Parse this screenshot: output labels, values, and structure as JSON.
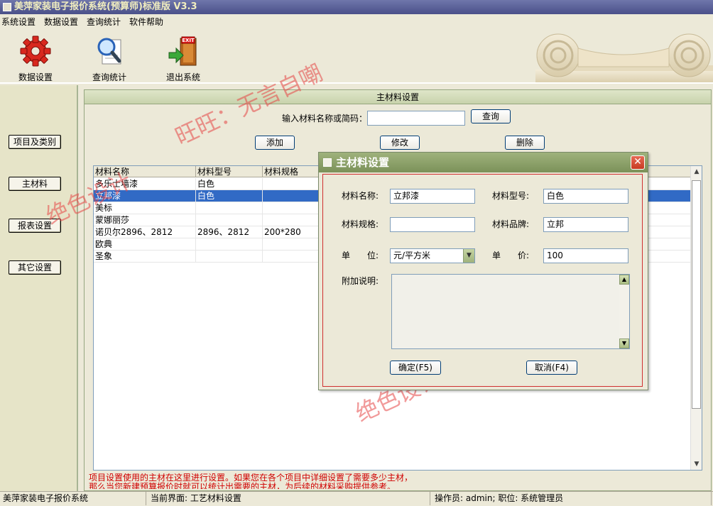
{
  "window": {
    "title": "美萍家装电子报价系统(预算师)标准版 V3.3"
  },
  "menu": [
    "系统设置",
    "数据设置",
    "查询统计",
    "软件帮助"
  ],
  "toolbar": {
    "data_settings": "数据设置",
    "query_stats": "查询统计",
    "exit": "退出系统",
    "exit_sign": "EXIT"
  },
  "sidebar": [
    "项目及类别",
    "主材料",
    "报表设置",
    "其它设置"
  ],
  "main": {
    "header": "主材料设置",
    "search_label": "输入材料名称或简码：",
    "search_value": "",
    "query_button": "查询",
    "add_button": "添加",
    "edit_button": "修改",
    "delete_button": "删除",
    "columns": [
      "材料名称",
      "材料型号",
      "材料规格"
    ],
    "rows": [
      [
        "多乐士墙漆",
        "白色",
        ""
      ],
      [
        "立邦漆",
        "白色",
        ""
      ],
      [
        "美标",
        "",
        ""
      ],
      [
        "蒙娜丽莎",
        "",
        ""
      ],
      [
        "诺贝尔2896、2812",
        "2896、2812",
        "200*280"
      ],
      [
        "欧典",
        "",
        ""
      ],
      [
        "圣象",
        "",
        ""
      ]
    ],
    "selected_row": 1,
    "hint_line1": "项目设置使用的主材在这里进行设置。如果您在各个项目中详细设置了需要多少主材，",
    "hint_line2": "那么当您新建预算报价时就可以统计出需要的主材，为后续的材料采购提供参考。"
  },
  "dialog": {
    "title": "主材料设置",
    "close": "✕",
    "name_label": "材料名称:",
    "name_value": "立邦漆",
    "model_label": "材料型号:",
    "model_value": "白色",
    "spec_label": "材料规格:",
    "spec_value": "",
    "brand_label": "材料品牌:",
    "brand_value": "立邦",
    "unit_label": "单　　位:",
    "unit_value": "元/平方米",
    "price_label": "单　　价:",
    "price_value": "100",
    "note_label": "附加说明:",
    "note_value": "",
    "ok_button": "确定(F5)",
    "cancel_button": "取消(F4)"
  },
  "statusbar": {
    "app": "美萍家装电子报价系统",
    "current": "当前界面: 工艺材料设置",
    "operator": "操作员: admin; 职位: 系统管理员"
  },
  "watermarks": {
    "wm1": "旺旺：无言自嘲",
    "wm2": "绝色设计",
    "wm3": "旺旺：无言自嘲",
    "wm4": "绝色设计"
  },
  "icons": {
    "data_settings": "red-gear-icon",
    "query_stats": "magnifier-document-icon",
    "exit": "exit-door-icon"
  }
}
